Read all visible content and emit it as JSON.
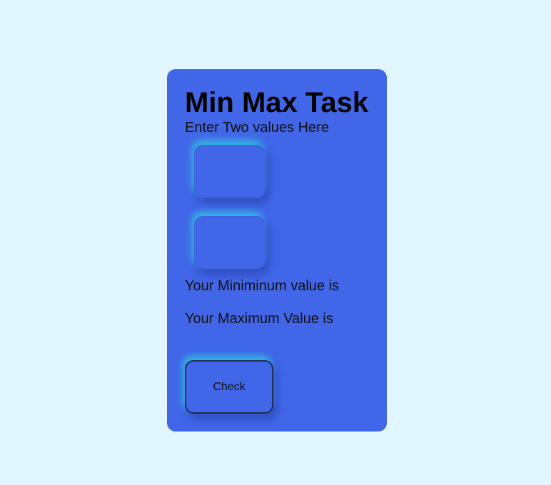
{
  "card": {
    "title": "Min Max Task",
    "subtitle": "Enter Two values Here",
    "inputs": [
      {
        "value": "",
        "placeholder": ""
      },
      {
        "value": "",
        "placeholder": ""
      }
    ],
    "min_label": "Your Miniminum value is",
    "max_label": "Your Maximum Value is",
    "check_label": "Check"
  },
  "colors": {
    "page_background": "#e1f6ff",
    "card_background": "#4166e8",
    "glow": "#2dd7dc"
  }
}
